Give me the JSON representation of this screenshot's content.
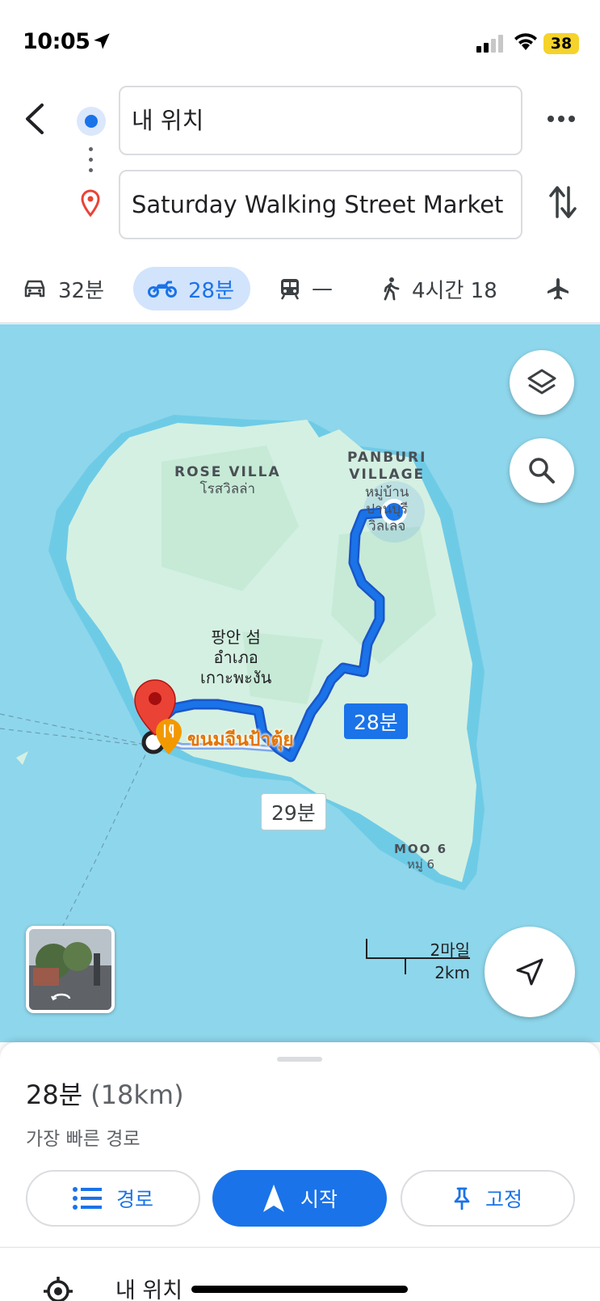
{
  "status_bar": {
    "time": "10:05",
    "battery": "38"
  },
  "directions": {
    "origin_value": "내 위치",
    "destination_value": "Saturday Walking Street Market"
  },
  "modes": {
    "car": "32분",
    "motorcycle": "28분",
    "transit": "—",
    "walk": "4시간 18"
  },
  "map": {
    "labels": {
      "rose_en": "ROSE VILLA",
      "rose_th": "โรสวิลล่า",
      "panburi_en_1": "PANBURI",
      "panburi_en_2": "VILLAGE",
      "panburi_th": "หมู่บ้าน ปานบุรี วิลเลจ",
      "island_ko": "팡안 섬",
      "island_th_1": "อำเภอ",
      "island_th_2": "เกาะพะงัน",
      "moo_en": "MOO 6",
      "moo_th": "หมู่ 6",
      "restaurant": "ขนมจีนป้าตุ้ย"
    },
    "eta_main": "28분",
    "eta_alt": "29분",
    "scale_mi": "2마일",
    "scale_km": "2km",
    "colors": {
      "route": "#1a73e8",
      "water": "#8ed6eb",
      "land": "#d4f0e2",
      "pin": "#ea4335"
    }
  },
  "sheet": {
    "duration": "28분",
    "distance": "(18km)",
    "subtitle": "가장 빠른 경로",
    "steps_btn": "경로",
    "start_btn": "시작",
    "pin_btn": "고정",
    "my_location": "내 위치"
  }
}
